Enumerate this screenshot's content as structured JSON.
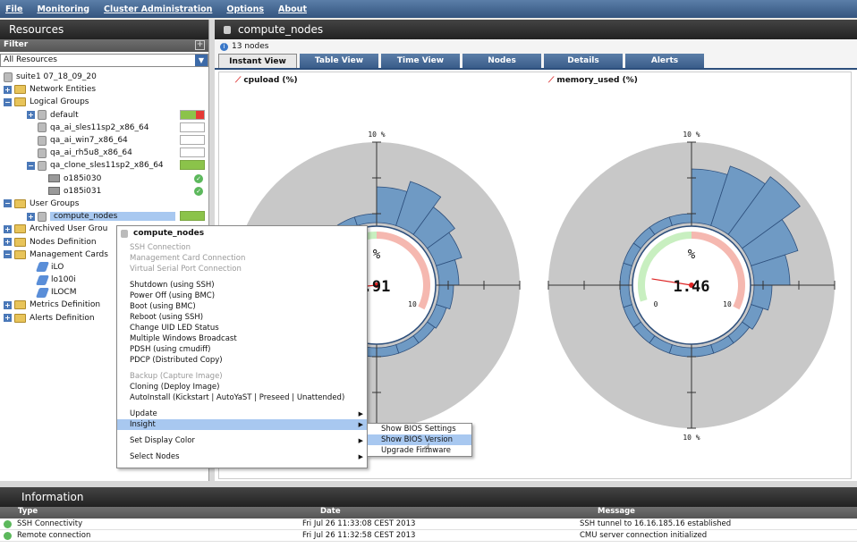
{
  "menubar": {
    "items": [
      "File",
      "Monitoring",
      "Cluster Administration",
      "Options",
      "About"
    ]
  },
  "left": {
    "title": "Resources",
    "filter_label": "Filter",
    "resource_select": "All Resources",
    "tree": [
      {
        "label": "suite1 07_18_09_20"
      },
      {
        "label": "Network Entities"
      },
      {
        "label": "Logical Groups"
      },
      {
        "label": "default"
      },
      {
        "label": "qa_ai_sles11sp2_x86_64"
      },
      {
        "label": "qa_ai_win7_x86_64"
      },
      {
        "label": "qa_ai_rh5u8_x86_64"
      },
      {
        "label": "qa_clone_sles11sp2_x86_64"
      },
      {
        "label": "o185i030"
      },
      {
        "label": "o185i031"
      },
      {
        "label": "User Groups"
      },
      {
        "label": "compute_nodes"
      },
      {
        "label": "Archived User Grou"
      },
      {
        "label": "Nodes Definition"
      },
      {
        "label": "Management Cards"
      },
      {
        "label": "iLO"
      },
      {
        "label": "lo100i"
      },
      {
        "label": "ILOCM"
      },
      {
        "label": "Metrics Definition"
      },
      {
        "label": "Alerts Definition"
      }
    ]
  },
  "main": {
    "title": "compute_nodes",
    "node_count": "13 nodes",
    "tabs": [
      "Instant View",
      "Table View",
      "Time View",
      "Nodes",
      "Details",
      "Alerts"
    ],
    "gauges": [
      {
        "label": "cpuload (%)",
        "value_text": ".91",
        "unit": "%",
        "top_tick": "10 %",
        "bottom_tick": "10 %",
        "min": "0",
        "max": "10"
      },
      {
        "label": "memory_used (%)",
        "value_text": "1.46",
        "unit": "%",
        "top_tick": "10 %",
        "bottom_tick": "10 %",
        "min": "0",
        "max": "10"
      }
    ]
  },
  "context_menu": {
    "title": "compute_nodes",
    "items": [
      "SSH Connection",
      "Management Card Connection",
      "Virtual Serial Port Connection",
      "Shutdown (using SSH)",
      "Power Off (using BMC)",
      "Boot (using BMC)",
      "Reboot (using SSH)",
      "Change UID LED Status",
      "Multiple Windows Broadcast",
      "PDSH (using cmudiff)",
      "PDCP (Distributed Copy)",
      "Backup (Capture Image)",
      "Cloning (Deploy Image)",
      "AutoInstall (Kickstart | AutoYaST | Preseed | Unattended)",
      "Update",
      "Insight",
      "Set Display Color",
      "Select Nodes"
    ]
  },
  "submenu": {
    "items": [
      "Show BIOS Settings",
      "Show BIOS Version",
      "Upgrade Firmware"
    ]
  },
  "info": {
    "title": "Information",
    "columns": [
      "Type",
      "Date",
      "Message"
    ],
    "rows": [
      {
        "type": "SSH Connectivity",
        "date": "Fri Jul 26 11:33:08 CEST 2013",
        "message": "SSH tunnel to 16.16.185.16 established"
      },
      {
        "type": "Remote connection",
        "date": "Fri Jul 26 11:32:58 CEST 2013",
        "message": "CMU server connection initialized"
      }
    ]
  },
  "colors": {
    "accent": "#3c6aa8",
    "status_green": "#8bc34a",
    "status_red": "#e53935",
    "gauge_bar": "#6f9ac4"
  }
}
